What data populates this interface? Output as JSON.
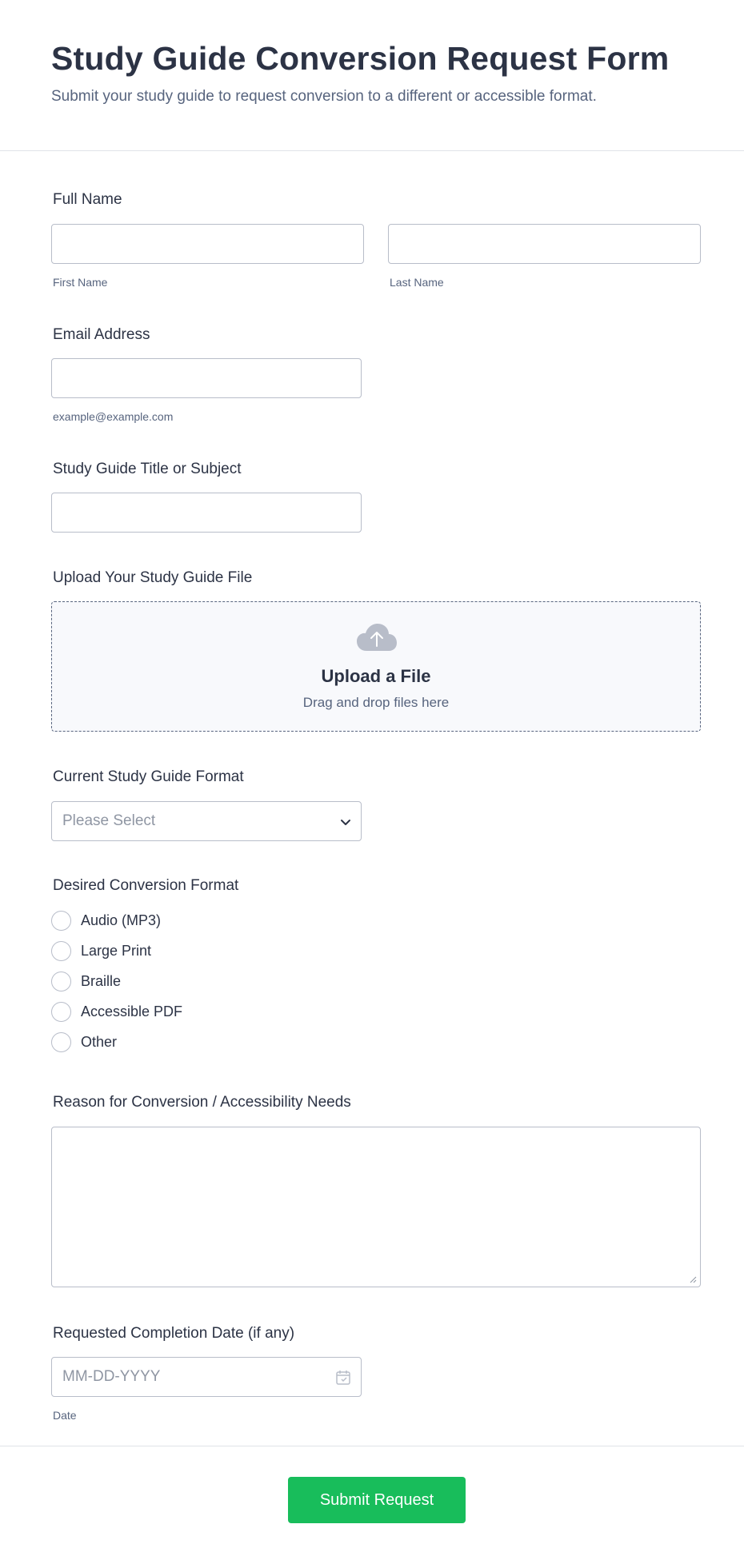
{
  "header": {
    "title": "Study Guide Conversion Request Form",
    "subtitle": "Submit your study guide to request conversion to a different or accessible format."
  },
  "fields": {
    "full_name": {
      "label": "Full Name",
      "first_sublabel": "First Name",
      "last_sublabel": "Last Name",
      "first_value": "",
      "last_value": ""
    },
    "email": {
      "label": "Email Address",
      "sublabel": "example@example.com",
      "value": ""
    },
    "guide_title": {
      "label": "Study Guide Title or Subject",
      "value": ""
    },
    "upload": {
      "label": "Upload Your Study Guide File",
      "icon": "cloud-upload-icon",
      "title": "Upload a File",
      "subtitle": "Drag and drop files here"
    },
    "current_format": {
      "label": "Current Study Guide Format",
      "selected": "Please Select",
      "icon": "chevron-down-icon"
    },
    "desired_format": {
      "label": "Desired Conversion Format",
      "options": [
        "Audio (MP3)",
        "Large Print",
        "Braille",
        "Accessible PDF",
        "Other"
      ]
    },
    "reason": {
      "label": "Reason for Conversion / Accessibility Needs",
      "value": ""
    },
    "completion_date": {
      "label": "Requested Completion Date (if any)",
      "placeholder": "MM-DD-YYYY",
      "sublabel": "Date",
      "icon": "calendar-icon"
    }
  },
  "submit": {
    "label": "Submit Request",
    "color": "#18bd5b"
  },
  "colors": {
    "text": "#2c3345",
    "muted": "#57647e",
    "border": "#b8bdc9",
    "placeholder": "#8f96a3"
  }
}
